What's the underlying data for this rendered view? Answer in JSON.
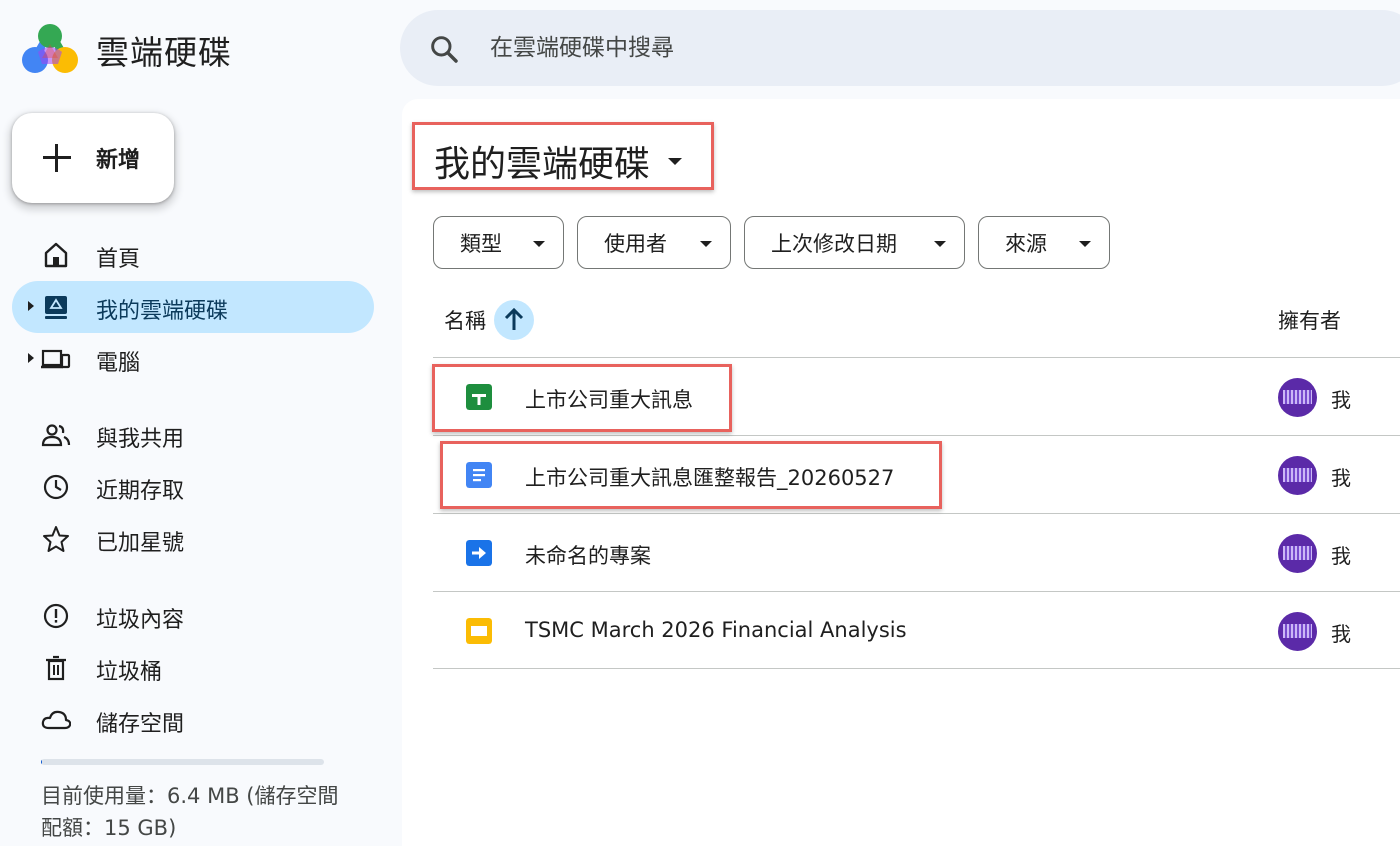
{
  "app": {
    "title": "雲端硬碟"
  },
  "search": {
    "placeholder": "在雲端硬碟中搜尋"
  },
  "sidebar": {
    "new_label": "新增",
    "items": [
      {
        "label": "首頁",
        "icon": "home-icon"
      },
      {
        "label": "我的雲端硬碟",
        "icon": "my-drive-icon",
        "active": true
      },
      {
        "label": "電腦",
        "icon": "computers-icon"
      },
      {
        "label": "與我共用",
        "icon": "shared-icon"
      },
      {
        "label": "近期存取",
        "icon": "clock-icon"
      },
      {
        "label": "已加星號",
        "icon": "star-icon"
      },
      {
        "label": "垃圾內容",
        "icon": "spam-icon"
      },
      {
        "label": "垃圾桶",
        "icon": "trash-icon"
      },
      {
        "label": "儲存空間",
        "icon": "cloud-icon"
      }
    ],
    "storage": {
      "used_fraction": 0.0004,
      "text": "目前使用量：6.4 MB (儲存空間配額：15 GB)"
    }
  },
  "main": {
    "title": "我的雲端硬碟",
    "filters": [
      "類型",
      "使用者",
      "上次修改日期",
      "來源"
    ],
    "columns": {
      "name": "名稱",
      "owner": "擁有者"
    },
    "files": [
      {
        "name": "上市公司重大訊息",
        "type": "sheets",
        "owner": "我"
      },
      {
        "name": "上市公司重大訊息匯整報告_20260527",
        "type": "docs",
        "owner": "我"
      },
      {
        "name": "未命名的專案",
        "type": "script",
        "owner": "我"
      },
      {
        "name": "TSMC March 2026 Financial Analysis",
        "type": "slides",
        "owner": "我"
      }
    ]
  },
  "colors": {
    "accent": "#0b57d0",
    "active_bg": "#c2e7ff",
    "highlight": "#e8625d",
    "sheets": "#1e8e3e",
    "docs": "#4285f4",
    "script": "#1a73e8",
    "slides": "#fbbc04"
  }
}
